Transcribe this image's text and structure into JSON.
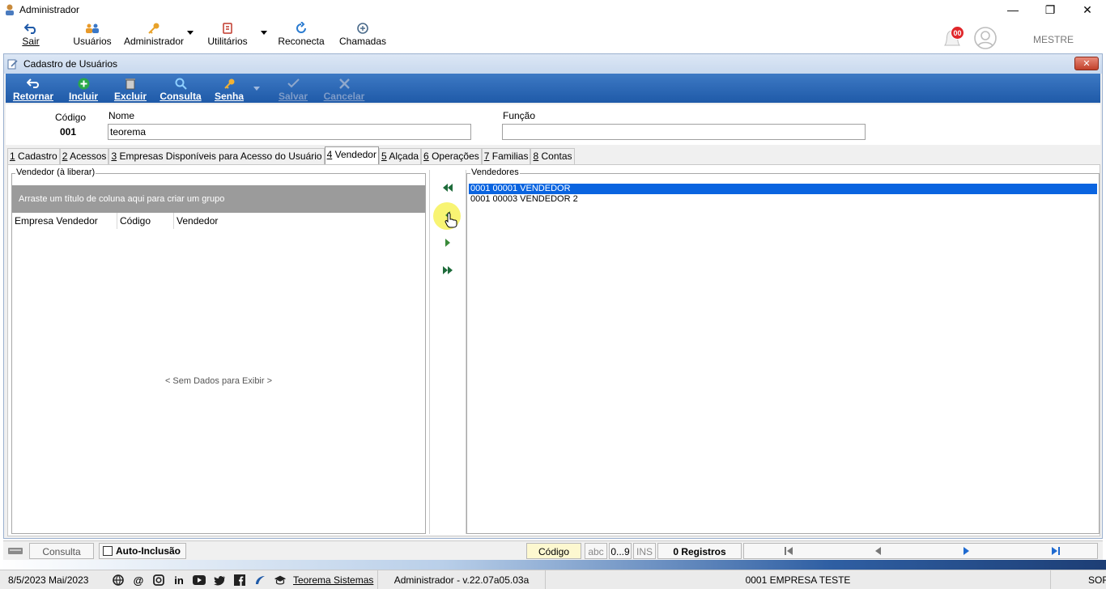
{
  "window": {
    "title": "Administrador",
    "controls": {
      "minimize": "—",
      "maximize": "❐",
      "close": "✕"
    }
  },
  "main_toolbar": {
    "items": [
      {
        "label": "Sair",
        "icon": "exit-arrow-icon"
      },
      {
        "label": "Usuários",
        "icon": "users-icon"
      },
      {
        "label": "Administrador",
        "icon": "key-icon"
      },
      {
        "label": "Utilitários",
        "icon": "tools-icon"
      },
      {
        "label": "Reconecta",
        "icon": "reconnect-icon"
      },
      {
        "label": "Chamadas",
        "icon": "support-calls-icon"
      }
    ],
    "notification_count": "00",
    "user_name": "MESTRE"
  },
  "child_window": {
    "title": "Cadastro de Usuários",
    "close_label": "✕"
  },
  "ribbon": {
    "buttons": [
      {
        "label": "Retornar",
        "icon": "return-icon",
        "enabled": true
      },
      {
        "label": "Incluir",
        "icon": "add-icon",
        "enabled": true
      },
      {
        "label": "Excluir",
        "icon": "trash-icon",
        "enabled": true
      },
      {
        "label": "Consulta",
        "icon": "search-icon",
        "enabled": true
      },
      {
        "label": "Senha",
        "icon": "key-icon",
        "enabled": true
      },
      {
        "label": "Salvar",
        "icon": "check-icon",
        "enabled": false
      },
      {
        "label": "Cancelar",
        "icon": "cancel-icon",
        "enabled": false
      }
    ]
  },
  "header": {
    "codigo_label": "Código",
    "codigo_value": "001",
    "nome_label": "Nome",
    "nome_value": "teorema",
    "funcao_label": "Função",
    "funcao_value": ""
  },
  "tabs": [
    {
      "num": "1",
      "label": " Cadastro"
    },
    {
      "num": "2",
      "label": " Acessos"
    },
    {
      "num": "3",
      "label": " Empresas Disponíveis para Acesso do Usuário"
    },
    {
      "num": "4",
      "label": " Vendedor",
      "active": true
    },
    {
      "num": "5",
      "label": " Alçada"
    },
    {
      "num": "6",
      "label": " Operações"
    },
    {
      "num": "7",
      "label": " Familias"
    },
    {
      "num": "8",
      "label": " Contas"
    }
  ],
  "left_panel": {
    "title": "Vendedor (à liberar)",
    "group_hint": "Arraste um título de coluna aqui para criar um grupo",
    "columns": [
      "Empresa Vendedor",
      "Código",
      "Vendedor"
    ],
    "empty_text": "< Sem Dados para Exibir >"
  },
  "move_buttons": {
    "all_left": "⏪",
    "one_left": "◀",
    "one_right": "▶",
    "all_right": "⏩"
  },
  "right_panel": {
    "title": "Vendedores",
    "items": [
      {
        "text": "0001 00001 VENDEDOR",
        "selected": true
      },
      {
        "text": "0001 00003 VENDEDOR 2",
        "selected": false
      }
    ]
  },
  "status_bar": {
    "mode": "Consulta",
    "auto_inclusao": "Auto-Inclusão",
    "auto_inclusao_checked": false,
    "search_field": "Código",
    "abc": "abc",
    "digits": "0...9",
    "ins": "INS",
    "records": "0 Registros"
  },
  "bottom_bar": {
    "date": "8/5/2023 Mai/2023",
    "company_link": "Teorema Sistemas",
    "session": "Administrador - v.22.07a05.03a",
    "empresa": "0001 EMPRESA TESTE",
    "right_text": "SOF"
  },
  "colors": {
    "ribbon": "#2e6ab8",
    "selection": "#0a64e0",
    "notif_badge": "#e0262a"
  }
}
